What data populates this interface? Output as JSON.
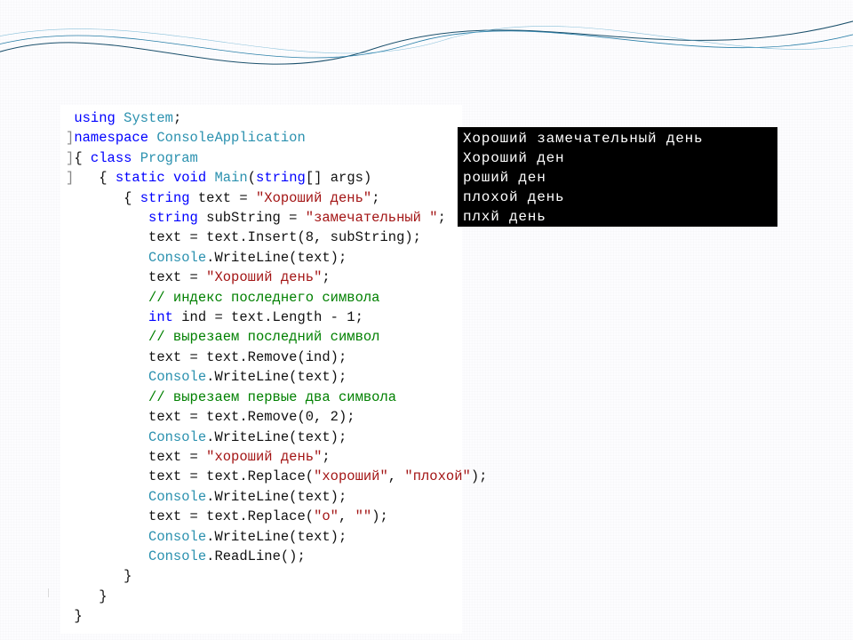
{
  "code": {
    "lines": [
      {
        "indent": 0,
        "marker": "",
        "tokens": [
          [
            "kw",
            "using"
          ],
          [
            "",
            " "
          ],
          [
            "cls",
            "System"
          ],
          [
            "",
            ";"
          ]
        ]
      },
      {
        "indent": 0,
        "marker": "]",
        "tokens": [
          [
            "kw",
            "namespace"
          ],
          [
            "",
            " "
          ],
          [
            "cls",
            "ConsoleApplication"
          ]
        ]
      },
      {
        "indent": 0,
        "marker": "]",
        "tokens": [
          [
            "",
            "{ "
          ],
          [
            "kw",
            "class"
          ],
          [
            "",
            " "
          ],
          [
            "cls",
            "Program"
          ]
        ]
      },
      {
        "indent": 1,
        "marker": "]",
        "tokens": [
          [
            "",
            "{ "
          ],
          [
            "kw",
            "static"
          ],
          [
            "",
            " "
          ],
          [
            "kw",
            "void"
          ],
          [
            "",
            " "
          ],
          [
            "cls",
            "Main"
          ],
          [
            "",
            "("
          ],
          [
            "kw",
            "string"
          ],
          [
            "",
            "[] args)"
          ]
        ]
      },
      {
        "indent": 2,
        "marker": "",
        "tokens": [
          [
            "",
            "{ "
          ],
          [
            "kw",
            "string"
          ],
          [
            "",
            " text = "
          ],
          [
            "str",
            "\"Хороший день\""
          ],
          [
            "",
            ";"
          ]
        ]
      },
      {
        "indent": 3,
        "marker": "",
        "tokens": [
          [
            "kw",
            "string"
          ],
          [
            "",
            " subString = "
          ],
          [
            "str",
            "\"замечательный \""
          ],
          [
            "",
            ";"
          ]
        ]
      },
      {
        "indent": 3,
        "marker": "",
        "tokens": [
          [
            "",
            "text = text.Insert(8, subString);"
          ]
        ]
      },
      {
        "indent": 3,
        "marker": "",
        "tokens": [
          [
            "cls",
            "Console"
          ],
          [
            "",
            ".WriteLine(text);"
          ]
        ]
      },
      {
        "indent": 3,
        "marker": "",
        "tokens": [
          [
            "",
            "text = "
          ],
          [
            "str",
            "\"Хороший день\""
          ],
          [
            "",
            ";"
          ]
        ]
      },
      {
        "indent": 3,
        "marker": "",
        "tokens": [
          [
            "cmt",
            "// индекс последнего символа"
          ]
        ]
      },
      {
        "indent": 3,
        "marker": "",
        "tokens": [
          [
            "kw",
            "int"
          ],
          [
            "",
            " ind = text.Length - 1;"
          ]
        ]
      },
      {
        "indent": 3,
        "marker": "",
        "tokens": [
          [
            "cmt",
            "// вырезаем последний символ"
          ]
        ]
      },
      {
        "indent": 3,
        "marker": "",
        "tokens": [
          [
            "",
            "text = text.Remove(ind);"
          ]
        ]
      },
      {
        "indent": 3,
        "marker": "",
        "tokens": [
          [
            "cls",
            "Console"
          ],
          [
            "",
            ".WriteLine(text);"
          ]
        ]
      },
      {
        "indent": 3,
        "marker": "",
        "tokens": [
          [
            "cmt",
            "// вырезаем первые два символа"
          ]
        ]
      },
      {
        "indent": 3,
        "marker": "",
        "tokens": [
          [
            "",
            "text = text.Remove(0, 2);"
          ]
        ]
      },
      {
        "indent": 3,
        "marker": "",
        "tokens": [
          [
            "cls",
            "Console"
          ],
          [
            "",
            ".WriteLine(text);"
          ]
        ]
      },
      {
        "indent": 3,
        "marker": "",
        "tokens": [
          [
            "",
            "text = "
          ],
          [
            "str",
            "\"хороший день\""
          ],
          [
            "",
            ";"
          ]
        ]
      },
      {
        "indent": 3,
        "marker": "",
        "tokens": [
          [
            "",
            "text = text.Replace("
          ],
          [
            "str",
            "\"хороший\""
          ],
          [
            "",
            ", "
          ],
          [
            "str",
            "\"плохой\""
          ],
          [
            "",
            ");"
          ]
        ]
      },
      {
        "indent": 3,
        "marker": "",
        "tokens": [
          [
            "cls",
            "Console"
          ],
          [
            "",
            ".WriteLine(text);"
          ]
        ]
      },
      {
        "indent": 3,
        "marker": "",
        "tokens": [
          [
            "",
            "text = text.Replace("
          ],
          [
            "str",
            "\"о\""
          ],
          [
            "",
            ", "
          ],
          [
            "str",
            "\"\""
          ],
          [
            "",
            ");"
          ]
        ]
      },
      {
        "indent": 3,
        "marker": "",
        "tokens": [
          [
            "cls",
            "Console"
          ],
          [
            "",
            ".WriteLine(text);"
          ]
        ]
      },
      {
        "indent": 3,
        "marker": "",
        "tokens": [
          [
            "cls",
            "Console"
          ],
          [
            "",
            ".ReadLine();"
          ]
        ]
      },
      {
        "indent": 2,
        "marker": "",
        "tokens": [
          [
            "",
            "}"
          ]
        ]
      },
      {
        "indent": 1,
        "marker": "",
        "tokens": [
          [
            "",
            "}"
          ]
        ]
      },
      {
        "indent": 0,
        "marker": "",
        "tokens": [
          [
            "",
            "}"
          ]
        ]
      }
    ]
  },
  "console": {
    "lines": [
      "Хороший замечательный день",
      "Хороший ден",
      "роший ден",
      "плохой день",
      "плхй день"
    ]
  }
}
